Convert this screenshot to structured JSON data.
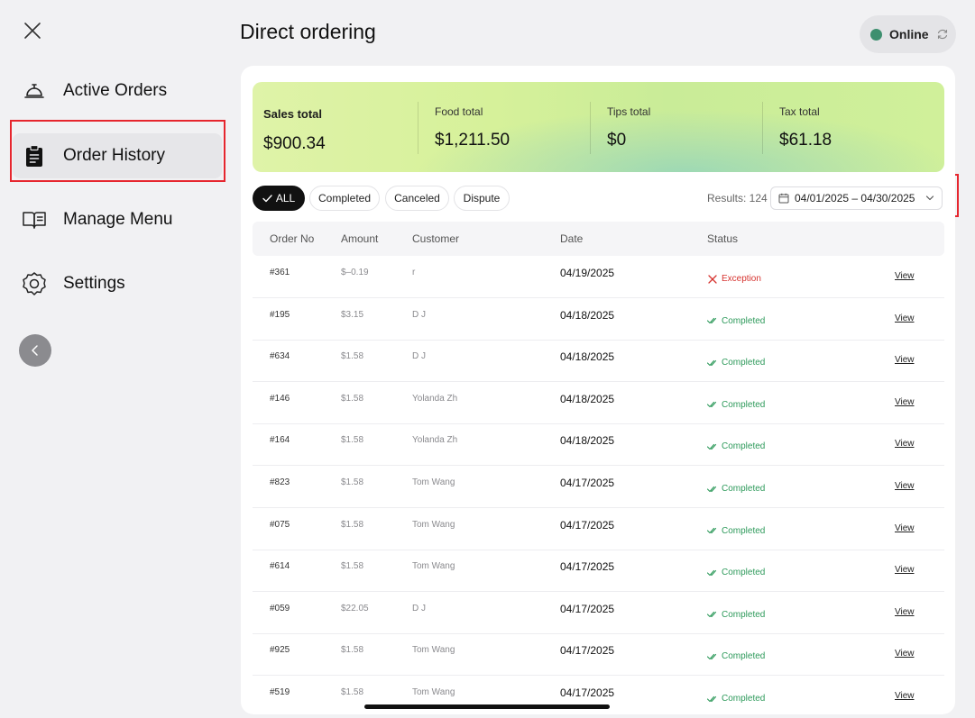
{
  "header": {
    "title": "Direct ordering",
    "online_label": "Online"
  },
  "sidebar": {
    "items": [
      {
        "label": "Active Orders",
        "icon": "service-bell-icon"
      },
      {
        "label": "Order History",
        "icon": "clipboard-icon"
      },
      {
        "label": "Manage Menu",
        "icon": "book-icon"
      },
      {
        "label": "Settings",
        "icon": "gear-icon"
      }
    ],
    "active_item": "Order History"
  },
  "stats": {
    "sales_total": {
      "label": "Sales total",
      "value": "$900.34"
    },
    "food_total": {
      "label": "Food total",
      "value": "$1,211.50"
    },
    "tips_total": {
      "label": "Tips total",
      "value": "$0"
    },
    "tax_total": {
      "label": "Tax total",
      "value": "$61.18"
    }
  },
  "filters": {
    "chips": [
      "ALL",
      "Completed",
      "Canceled",
      "Dispute"
    ],
    "selected": "ALL",
    "results_label": "Results: 124",
    "date_range": "04/01/2025 – 04/30/2025"
  },
  "table": {
    "columns": [
      "Order No",
      "Amount",
      "Customer",
      "Date",
      "Status"
    ],
    "view_label": "View",
    "rows": [
      {
        "order": "#361",
        "amount": "$–0.19",
        "customer": "r",
        "date": "04/19/2025",
        "status": "Exception"
      },
      {
        "order": "#195",
        "amount": "$3.15",
        "customer": "D J",
        "date": "04/18/2025",
        "status": "Completed"
      },
      {
        "order": "#634",
        "amount": "$1.58",
        "customer": "D J",
        "date": "04/18/2025",
        "status": "Completed"
      },
      {
        "order": "#146",
        "amount": "$1.58",
        "customer": "Yolanda Zh",
        "date": "04/18/2025",
        "status": "Completed"
      },
      {
        "order": "#164",
        "amount": "$1.58",
        "customer": "Yolanda Zh",
        "date": "04/18/2025",
        "status": "Completed"
      },
      {
        "order": "#823",
        "amount": "$1.58",
        "customer": "Tom Wang",
        "date": "04/17/2025",
        "status": "Completed"
      },
      {
        "order": "#075",
        "amount": "$1.58",
        "customer": "Tom Wang",
        "date": "04/17/2025",
        "status": "Completed"
      },
      {
        "order": "#614",
        "amount": "$1.58",
        "customer": "Tom Wang",
        "date": "04/17/2025",
        "status": "Completed"
      },
      {
        "order": "#059",
        "amount": "$22.05",
        "customer": "D J",
        "date": "04/17/2025",
        "status": "Completed"
      },
      {
        "order": "#925",
        "amount": "$1.58",
        "customer": "Tom Wang",
        "date": "04/17/2025",
        "status": "Completed"
      },
      {
        "order": "#519",
        "amount": "$1.58",
        "customer": "Tom Wang",
        "date": "04/17/2025",
        "status": "Completed"
      }
    ]
  },
  "colors": {
    "online_dot": "#3d8f6f",
    "completed": "#2e9a5b",
    "exception": "#d6332f",
    "annotation_box": "#e6262e",
    "active_chip": "#111111"
  }
}
